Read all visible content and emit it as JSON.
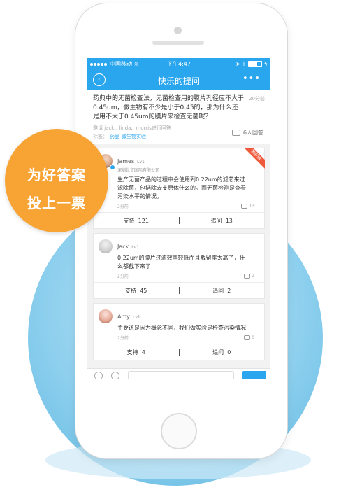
{
  "status_bar": {
    "carrier": "中国移动",
    "time": "下午4:47"
  },
  "nav": {
    "back_icon": "back-arrow-icon",
    "title": "快乐的提问",
    "more_label": "•••"
  },
  "question": {
    "text": "药典中的无菌检查法，无菌检查用的膜片孔径应不大于0.45um，微生物有不少是小于0.45的，那为什么还是用不大于0.45um的膜片来检查无菌呢？",
    "time": "20分前",
    "invite_text": "邀请 jack、linda、morris进行回答",
    "tags_label": "标签：",
    "tags": [
      "药品",
      "微生物实验"
    ],
    "answer_count": "6人回答"
  },
  "answers": [
    {
      "name": "James",
      "level": "Lv1",
      "company": "深圳世贸国际有限公司",
      "text": "生产无菌产品的过程中会使用到0.22um的滤芯来过滤除菌，包括除去支原体什么的。而无菌检测是查看污染水平的情况。",
      "time": "2分前",
      "comments": "13",
      "ribbon": "被采纳",
      "support_label": "支持",
      "support_count": "121",
      "followup_label": "追问",
      "followup_count": "13"
    },
    {
      "name": "Jack",
      "level": "Lv1",
      "text": "0.22um的膜片过滤效率较低而且截留率太高了，什么都截下来了",
      "time": "2分前",
      "comments": "2",
      "support_label": "支持",
      "support_count": "45",
      "followup_label": "追问",
      "followup_count": "2"
    },
    {
      "name": "Amy",
      "level": "Lv1",
      "text": "主要还是因为概念不同，我们做实验是检查污染情况",
      "time": "2分前",
      "comments": "0",
      "support_label": "支持",
      "support_count": "4",
      "followup_label": "追问",
      "followup_count": "0"
    }
  ],
  "badge": {
    "line1": "为好答案",
    "line2": "投上一票"
  },
  "colors": {
    "primary": "#29a6ee",
    "badge": "#f7a435",
    "ribbon": "#ef5a3c",
    "circle": "#8fd0ee"
  }
}
